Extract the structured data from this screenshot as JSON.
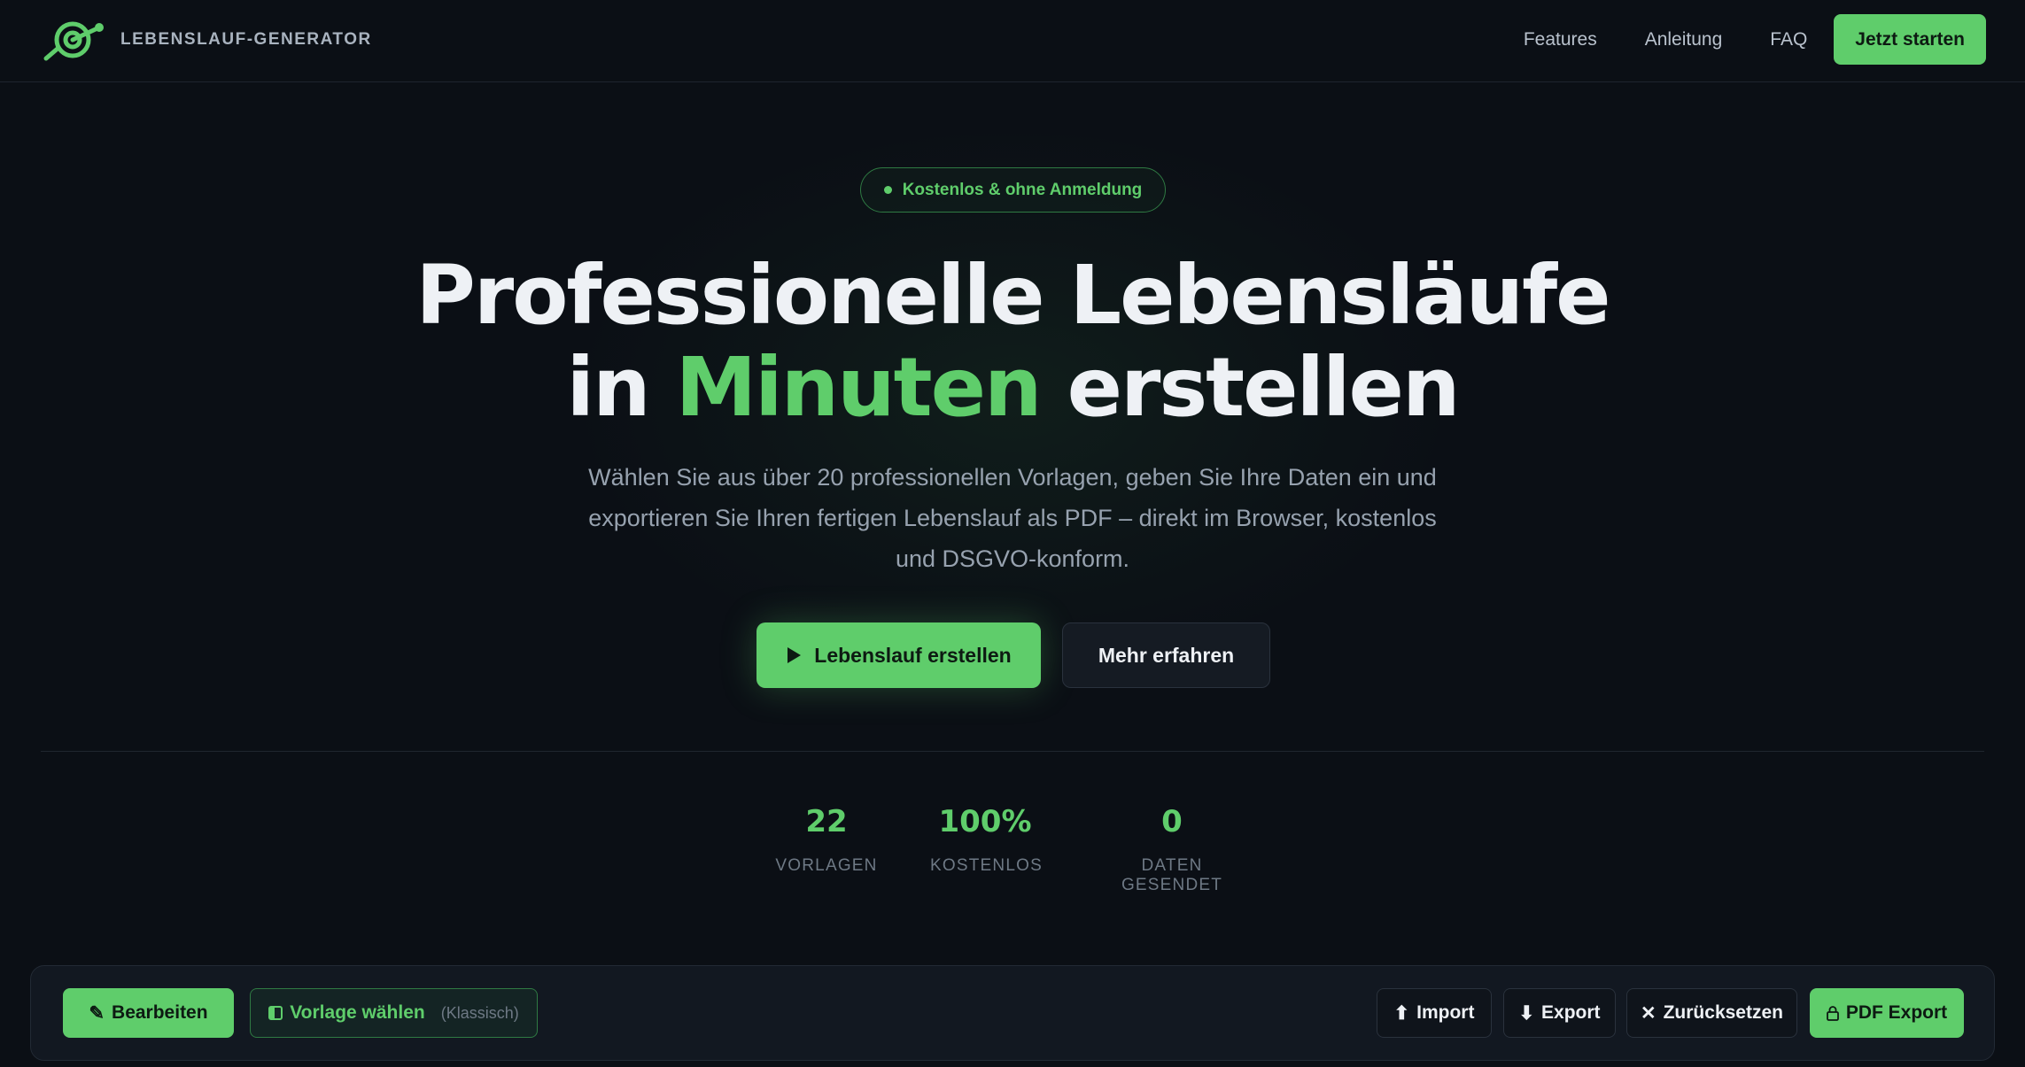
{
  "nav": {
    "brand_name": "LEBENSLAUF-GENERATOR",
    "links": [
      "Features",
      "Anleitung",
      "FAQ"
    ],
    "cta_label": "Jetzt starten"
  },
  "hero": {
    "badge": "Kostenlos & ohne Anmeldung",
    "headline_line1": "Professionelle Lebensläufe",
    "headline_in": "in",
    "headline_accent": "Minuten",
    "headline_end": "erstellen",
    "subtitle": "Wählen Sie aus über 20 professionellen Vorlagen, geben Sie Ihre Daten ein und exportieren Sie Ihren fertigen Lebenslauf als PDF – direkt im Browser, kostenlos und DSGVO-konform.",
    "primary_button": "Lebenslauf erstellen",
    "secondary_button": "Mehr erfahren"
  },
  "stats": [
    {
      "value": "22",
      "label": "VORLAGEN"
    },
    {
      "value": "100%",
      "label": "KOSTENLOS"
    },
    {
      "value": "0",
      "label": "DATEN GESENDET"
    }
  ],
  "toolbar": {
    "edit_label": "Bearbeiten",
    "template_label": "Vorlage wählen",
    "template_current": "(Klassisch)",
    "import_label": "Import",
    "export_label": "Export",
    "reset_label": "Zurücksetzen",
    "pdf_label": "PDF Export"
  },
  "colors": {
    "background": "#0b0f15",
    "accent": "#5fcd6b",
    "text": "#eef1f5",
    "muted": "#97a2af"
  },
  "icons": {
    "brand": "target-logo-icon",
    "play": "play-icon",
    "edit": "pencil-icon",
    "template": "layout-icon",
    "import": "arrow-up-icon",
    "export": "arrow-down-icon",
    "reset": "close-icon",
    "pdf": "lock-icon"
  }
}
